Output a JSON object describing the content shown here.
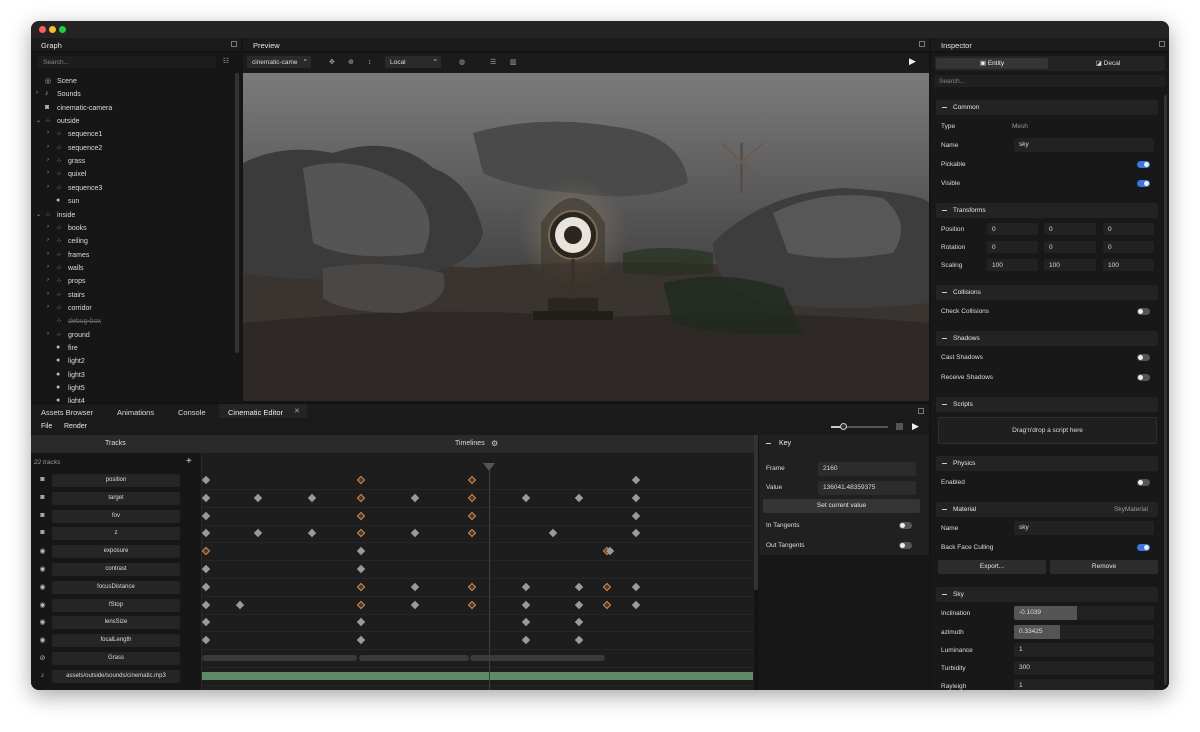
{
  "graph": {
    "title": "Graph",
    "search_placeholder": "Search...",
    "items": [
      {
        "label": "Scene",
        "icon": "scene-icon",
        "depth": 0,
        "expand": ""
      },
      {
        "label": "Sounds",
        "icon": "sound-icon",
        "depth": 0,
        "expand": "›"
      },
      {
        "label": "cinematic-camera",
        "icon": "camera-icon",
        "depth": 0,
        "expand": ""
      },
      {
        "label": "outside",
        "icon": "group-icon",
        "depth": 0,
        "expand": "⌄"
      },
      {
        "label": "sequence1",
        "icon": "group-icon",
        "depth": 1,
        "expand": "›"
      },
      {
        "label": "sequence2",
        "icon": "group-icon",
        "depth": 1,
        "expand": "›"
      },
      {
        "label": "grass",
        "icon": "group-icon",
        "depth": 1,
        "expand": "›"
      },
      {
        "label": "quixel",
        "icon": "group-icon",
        "depth": 1,
        "expand": "›"
      },
      {
        "label": "sequence3",
        "icon": "group-icon",
        "depth": 1,
        "expand": "›"
      },
      {
        "label": "sun",
        "icon": "light-icon",
        "depth": 1,
        "expand": ""
      },
      {
        "label": "inside",
        "icon": "group-icon",
        "depth": 0,
        "expand": "⌄"
      },
      {
        "label": "books",
        "icon": "group-icon",
        "depth": 1,
        "expand": "›"
      },
      {
        "label": "ceiling",
        "icon": "group-icon",
        "depth": 1,
        "expand": "›"
      },
      {
        "label": "frames",
        "icon": "group-icon",
        "depth": 1,
        "expand": "›"
      },
      {
        "label": "walls",
        "icon": "group-icon",
        "depth": 1,
        "expand": "›"
      },
      {
        "label": "props",
        "icon": "group-icon",
        "depth": 1,
        "expand": "›"
      },
      {
        "label": "stairs",
        "icon": "group-icon",
        "depth": 1,
        "expand": "›"
      },
      {
        "label": "corridor",
        "icon": "group-icon",
        "depth": 1,
        "expand": "›"
      },
      {
        "label": "debug-box",
        "icon": "group-icon",
        "depth": 1,
        "expand": "",
        "disabled": true
      },
      {
        "label": "ground",
        "icon": "group-icon",
        "depth": 1,
        "expand": "›"
      },
      {
        "label": "fire",
        "icon": "light-icon",
        "depth": 1,
        "expand": ""
      },
      {
        "label": "light2",
        "icon": "light-icon",
        "depth": 1,
        "expand": ""
      },
      {
        "label": "light3",
        "icon": "light-icon",
        "depth": 1,
        "expand": ""
      },
      {
        "label": "light5",
        "icon": "light-icon",
        "depth": 1,
        "expand": ""
      },
      {
        "label": "light4",
        "icon": "light-icon",
        "depth": 1,
        "expand": ""
      }
    ]
  },
  "preview": {
    "title": "Preview",
    "camera_select": "cinematic-came",
    "space_select": "Local"
  },
  "inspector": {
    "title": "Inspector",
    "tabs": {
      "entity": "Entity",
      "decal": "Decal"
    },
    "search_placeholder": "Search...",
    "common": {
      "title": "Common",
      "type_label": "Type",
      "type_value": "Mesh",
      "name_label": "Name",
      "name_value": "sky",
      "pickable_label": "Pickable",
      "visible_label": "Visible"
    },
    "transforms": {
      "title": "Transforms",
      "position_label": "Position",
      "rotation_label": "Rotation",
      "scaling_label": "Scaling",
      "position": [
        "0",
        "0",
        "0"
      ],
      "rotation": [
        "0",
        "0",
        "0"
      ],
      "scaling": [
        "100",
        "100",
        "100"
      ]
    },
    "collisions": {
      "title": "Collisions",
      "check_label": "Check Collisions"
    },
    "shadows": {
      "title": "Shadows",
      "cast_label": "Cast Shadows",
      "receive_label": "Receive Shadows"
    },
    "scripts": {
      "title": "Scripts",
      "drop_label": "Drag'n'drop a script here"
    },
    "physics": {
      "title": "Physics",
      "enabled_label": "Enabled"
    },
    "material": {
      "title": "Material",
      "material_name": "SkyMaterial",
      "name_label": "Name",
      "name_value": "sky",
      "backface_label": "Back Face Culling",
      "export_label": "Export...",
      "remove_label": "Remove"
    },
    "sky": {
      "title": "Sky",
      "inclination_label": "Inclination",
      "inclination_value": "-0.1039",
      "inclination_fill": 0.45,
      "azimuth_label": "azimuth",
      "azimuth_value": "0.33425",
      "azimuth_fill": 0.33,
      "luminance_label": "Luminance",
      "luminance_value": "1",
      "turbidity_label": "Turbidity",
      "turbidity_value": "300",
      "rayleigh_label": "Rayleigh",
      "rayleigh_value": "1"
    }
  },
  "bottom_tabs": [
    "Assets Browser",
    "Animations",
    "Console",
    "Cinematic Editor"
  ],
  "editor": {
    "menu": {
      "file": "File",
      "render": "Render"
    },
    "tracks_label": "Tracks",
    "timelines_label": "Timelines",
    "track_count": "22 tracks",
    "tracks": [
      {
        "name": "position",
        "icon": "camera-icon"
      },
      {
        "name": "target",
        "icon": "camera-icon"
      },
      {
        "name": "fov",
        "icon": "camera-icon"
      },
      {
        "name": "z",
        "icon": "camera-icon"
      },
      {
        "name": "exposure",
        "icon": "target-icon"
      },
      {
        "name": "contrast",
        "icon": "target-icon"
      },
      {
        "name": "focusDistance",
        "icon": "target-icon"
      },
      {
        "name": "fStop",
        "icon": "target-icon"
      },
      {
        "name": "lensSize",
        "icon": "target-icon"
      },
      {
        "name": "focalLength",
        "icon": "target-icon"
      },
      {
        "name": "Grass",
        "icon": "link-icon"
      },
      {
        "name": "assets/outside/sounds/cinematic.mp3",
        "icon": "sound-icon"
      }
    ],
    "key": {
      "title": "Key",
      "frame_label": "Frame",
      "frame_value": "2160",
      "value_label": "Value",
      "value_value": "136041.48359375",
      "set_label": "Set current value",
      "in_label": "In Tangents",
      "out_label": "Out Tangents"
    }
  }
}
